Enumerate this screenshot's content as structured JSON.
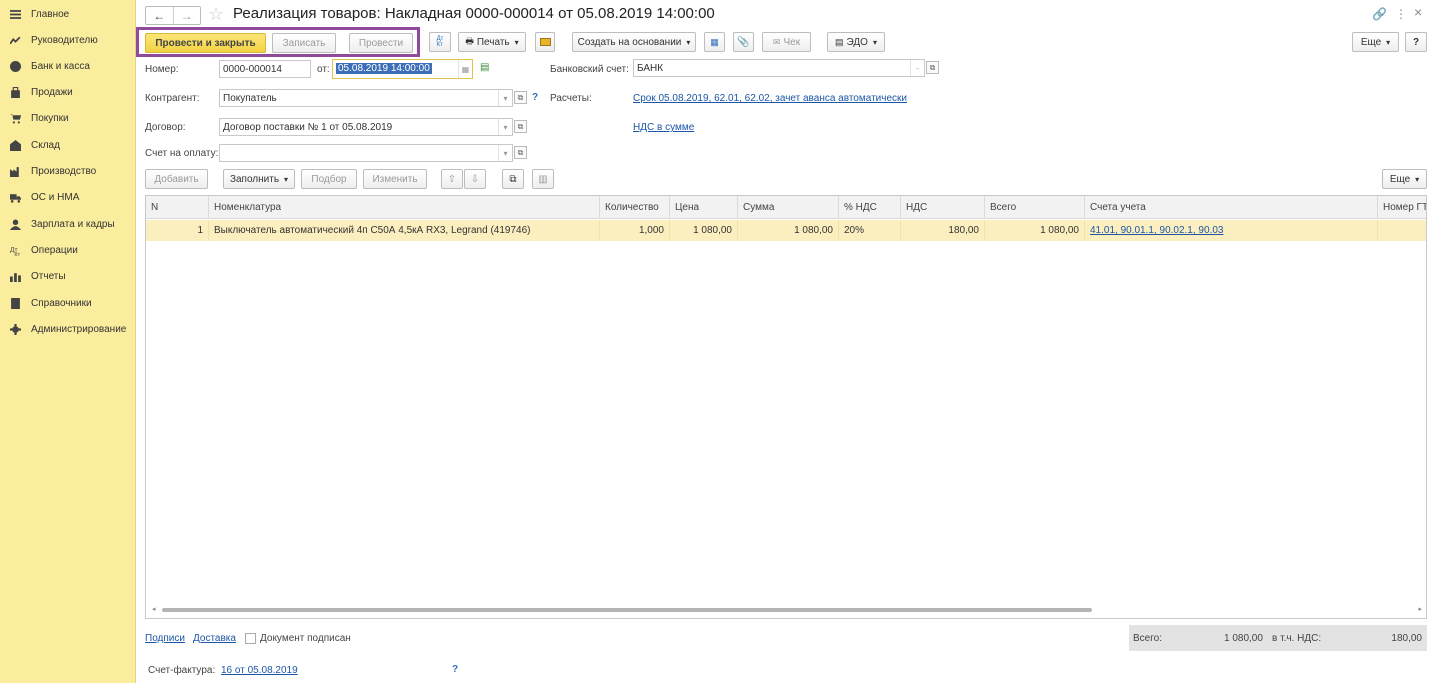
{
  "sidebar": {
    "items": [
      {
        "label": "Главное",
        "icon": "menu-icon"
      },
      {
        "label": "Руководителю",
        "icon": "trend-icon"
      },
      {
        "label": "Банк и касса",
        "icon": "bank-icon"
      },
      {
        "label": "Продажи",
        "icon": "bag-icon"
      },
      {
        "label": "Покупки",
        "icon": "cart-icon"
      },
      {
        "label": "Склад",
        "icon": "warehouse-icon"
      },
      {
        "label": "Производство",
        "icon": "factory-icon"
      },
      {
        "label": "ОС и НМА",
        "icon": "truck-icon"
      },
      {
        "label": "Зарплата и кадры",
        "icon": "person-icon"
      },
      {
        "label": "Операции",
        "icon": "operations-icon"
      },
      {
        "label": "Отчеты",
        "icon": "chart-icon"
      },
      {
        "label": "Справочники",
        "icon": "book-icon"
      },
      {
        "label": "Администрирование",
        "icon": "gear-icon"
      }
    ]
  },
  "header": {
    "back": "←",
    "forward": "→",
    "star": "☆",
    "title": "Реализация товаров: Накладная 0000-000014 от 05.08.2019 14:00:00",
    "link_icon": "🔗",
    "more_icon": "⋮",
    "close_icon": "×"
  },
  "toolbar": {
    "post_close": "Провести и закрыть",
    "save": "Записать",
    "post": "Провести",
    "print": "Печать",
    "create_based": "Создать на основании",
    "check": "Чек",
    "edo": "ЭДО",
    "more": "Еще",
    "help": "?"
  },
  "form": {
    "number_label": "Номер:",
    "number_value": "0000-000014",
    "date_label": "от:",
    "date_value": "05.08.2019 14:00:00",
    "bank_label": "Банковский счет:",
    "bank_value": "БАНК",
    "counterparty_label": "Контрагент:",
    "counterparty_value": "Покупатель",
    "settlements_label": "Расчеты:",
    "settlements_link": "Срок 05.08.2019, 62.01, 62.02, зачет аванса автоматически",
    "contract_label": "Договор:",
    "contract_value": "Договор поставки № 1 от 05.08.2019",
    "vat_link": "НДС в сумме",
    "invoice_label": "Счет на оплату:",
    "invoice_value": "",
    "help": "?"
  },
  "table_toolbar": {
    "add": "Добавить",
    "fill": "Заполнить",
    "select": "Подбор",
    "change": "Изменить",
    "up": "⇧",
    "down": "⇩",
    "more": "Еще"
  },
  "table": {
    "columns": [
      "N",
      "Номенклатура",
      "Количество",
      "Цена",
      "Сумма",
      "% НДС",
      "НДС",
      "Всего",
      "Счета учета",
      "Номер ГТ..."
    ],
    "rows": [
      [
        "1",
        "Выключатель автоматический 4п С50А 4,5кА RX3, Legrand (419746)",
        "1,000",
        "1 080,00",
        "1 080,00",
        "20%",
        "180,00",
        "1 080,00",
        "41.01, 90.01.1, 90.02.1, 90.03",
        ""
      ]
    ]
  },
  "footer": {
    "signatures": "Подписи",
    "delivery": "Доставка",
    "signed_label": "Документ подписан",
    "total_label": "Всего:",
    "total_value": "1 080,00",
    "vat_label": "в т.ч. НДС:",
    "vat_value": "180,00",
    "invoice_label": "Счет-фактура:",
    "invoice_link": "16 от 05.08.2019",
    "help": "?"
  },
  "colors": {
    "sidebar_bg": "#fbed9e",
    "primary_button": "#f3d242",
    "highlight_box": "#8f4a9e",
    "link": "#1d56a6",
    "selected_row": "#fbefc0"
  }
}
